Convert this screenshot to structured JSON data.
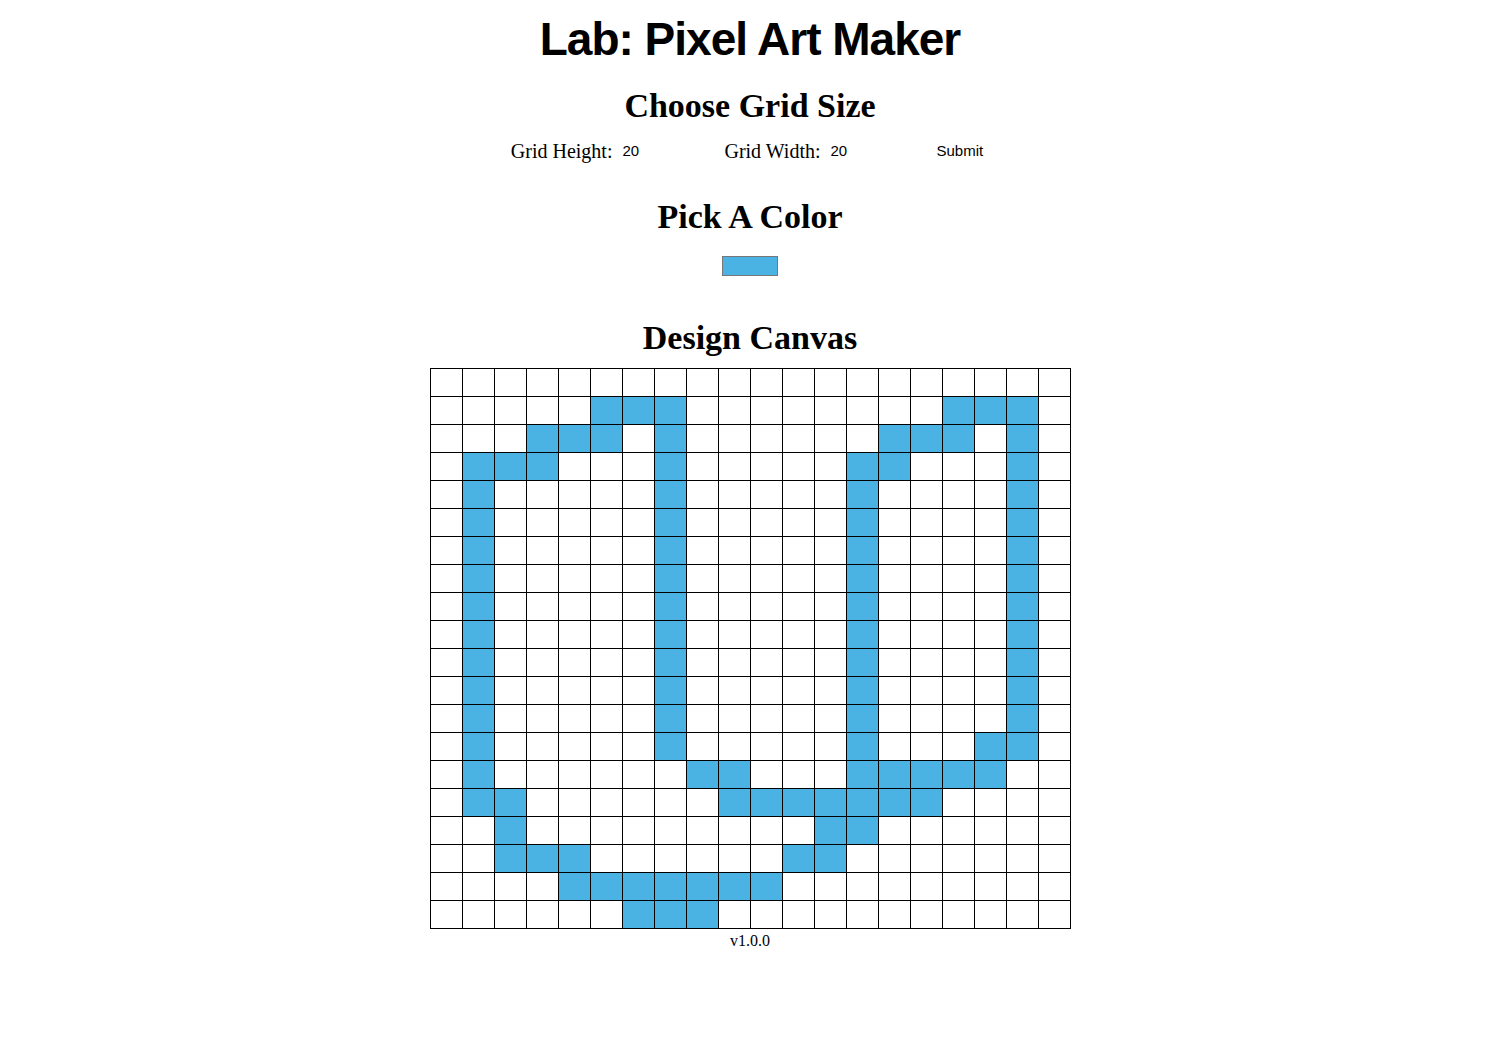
{
  "header": {
    "title": "Lab: Pixel Art Maker"
  },
  "grid_size": {
    "heading": "Choose Grid Size",
    "height_label": "Grid Height:",
    "height_value": "20",
    "width_label": "Grid Width:",
    "width_value": "20",
    "submit": "Submit"
  },
  "color_picker": {
    "heading": "Pick A Color",
    "color": "#4bb3e4"
  },
  "canvas": {
    "heading": "Design Canvas",
    "fill_color": "#4bb3e4",
    "cells": [
      [
        false,
        false,
        false,
        false,
        false,
        false,
        false,
        false,
        false,
        false,
        false,
        false,
        false,
        false,
        false,
        false,
        false,
        false,
        false,
        false
      ],
      [
        false,
        false,
        false,
        false,
        false,
        true,
        true,
        true,
        false,
        false,
        false,
        false,
        false,
        false,
        false,
        false,
        true,
        true,
        true,
        false
      ],
      [
        false,
        false,
        false,
        true,
        true,
        true,
        false,
        true,
        false,
        false,
        false,
        false,
        false,
        false,
        true,
        true,
        true,
        false,
        true,
        false
      ],
      [
        false,
        true,
        true,
        true,
        false,
        false,
        false,
        true,
        false,
        false,
        false,
        false,
        false,
        true,
        true,
        false,
        false,
        false,
        true,
        false
      ],
      [
        false,
        true,
        false,
        false,
        false,
        false,
        false,
        true,
        false,
        false,
        false,
        false,
        false,
        true,
        false,
        false,
        false,
        false,
        true,
        false
      ],
      [
        false,
        true,
        false,
        false,
        false,
        false,
        false,
        true,
        false,
        false,
        false,
        false,
        false,
        true,
        false,
        false,
        false,
        false,
        true,
        false
      ],
      [
        false,
        true,
        false,
        false,
        false,
        false,
        false,
        true,
        false,
        false,
        false,
        false,
        false,
        true,
        false,
        false,
        false,
        false,
        true,
        false
      ],
      [
        false,
        true,
        false,
        false,
        false,
        false,
        false,
        true,
        false,
        false,
        false,
        false,
        false,
        true,
        false,
        false,
        false,
        false,
        true,
        false
      ],
      [
        false,
        true,
        false,
        false,
        false,
        false,
        false,
        true,
        false,
        false,
        false,
        false,
        false,
        true,
        false,
        false,
        false,
        false,
        true,
        false
      ],
      [
        false,
        true,
        false,
        false,
        false,
        false,
        false,
        true,
        false,
        false,
        false,
        false,
        false,
        true,
        false,
        false,
        false,
        false,
        true,
        false
      ],
      [
        false,
        true,
        false,
        false,
        false,
        false,
        false,
        true,
        false,
        false,
        false,
        false,
        false,
        true,
        false,
        false,
        false,
        false,
        true,
        false
      ],
      [
        false,
        true,
        false,
        false,
        false,
        false,
        false,
        true,
        false,
        false,
        false,
        false,
        false,
        true,
        false,
        false,
        false,
        false,
        true,
        false
      ],
      [
        false,
        true,
        false,
        false,
        false,
        false,
        false,
        true,
        false,
        false,
        false,
        false,
        false,
        true,
        false,
        false,
        false,
        false,
        true,
        false
      ],
      [
        false,
        true,
        false,
        false,
        false,
        false,
        false,
        true,
        false,
        false,
        false,
        false,
        false,
        true,
        false,
        false,
        false,
        true,
        true,
        false
      ],
      [
        false,
        true,
        false,
        false,
        false,
        false,
        false,
        false,
        true,
        true,
        false,
        false,
        false,
        true,
        true,
        true,
        true,
        true,
        false,
        false
      ],
      [
        false,
        true,
        true,
        false,
        false,
        false,
        false,
        false,
        false,
        true,
        true,
        true,
        true,
        true,
        true,
        true,
        false,
        false,
        false,
        false
      ],
      [
        false,
        false,
        true,
        false,
        false,
        false,
        false,
        false,
        false,
        false,
        false,
        false,
        true,
        true,
        false,
        false,
        false,
        false,
        false,
        false
      ],
      [
        false,
        false,
        true,
        true,
        true,
        false,
        false,
        false,
        false,
        false,
        false,
        true,
        true,
        false,
        false,
        false,
        false,
        false,
        false,
        false
      ],
      [
        false,
        false,
        false,
        false,
        true,
        true,
        true,
        true,
        true,
        true,
        true,
        false,
        false,
        false,
        false,
        false,
        false,
        false,
        false,
        false
      ],
      [
        false,
        false,
        false,
        false,
        false,
        false,
        true,
        true,
        true,
        false,
        false,
        false,
        false,
        false,
        false,
        false,
        false,
        false,
        false,
        false
      ]
    ]
  },
  "footer": {
    "version": "v1.0.0"
  }
}
